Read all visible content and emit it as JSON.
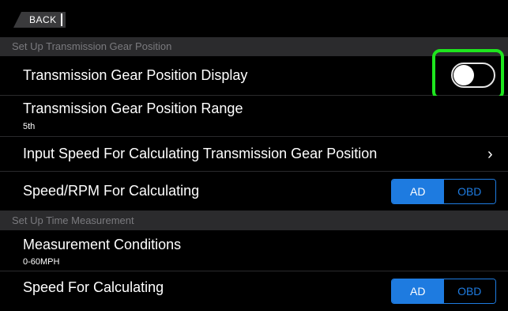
{
  "nav": {
    "back_label": "BACK"
  },
  "sections": [
    {
      "header": "Set Up Transmission Gear Position"
    },
    {
      "header": "Set Up Time Measurement"
    }
  ],
  "rows": {
    "gear_display": {
      "title": "Transmission Gear Position Display",
      "toggle_on": false
    },
    "gear_range": {
      "title": "Transmission Gear Position Range",
      "value": "5th"
    },
    "input_speed": {
      "title": "Input Speed For Calculating Transmission Gear Position"
    },
    "speed_rpm": {
      "title": "Speed/RPM For Calculating",
      "options": [
        "AD",
        "OBD"
      ],
      "selected": "AD"
    },
    "measurement": {
      "title": "Measurement Conditions",
      "value": "0-60MPH"
    },
    "speed_calc": {
      "title": "Speed For Calculating",
      "options": [
        "AD",
        "OBD"
      ],
      "selected": "AD"
    }
  },
  "colors": {
    "accent": "#1e7be0",
    "highlight": "#1ee61e",
    "section_bg": "#2b2b2d",
    "section_text": "#7a7a7e",
    "background": "#000000"
  },
  "icons": {
    "chevron": "chevron-right-icon",
    "toggle": "toggle-switch"
  }
}
